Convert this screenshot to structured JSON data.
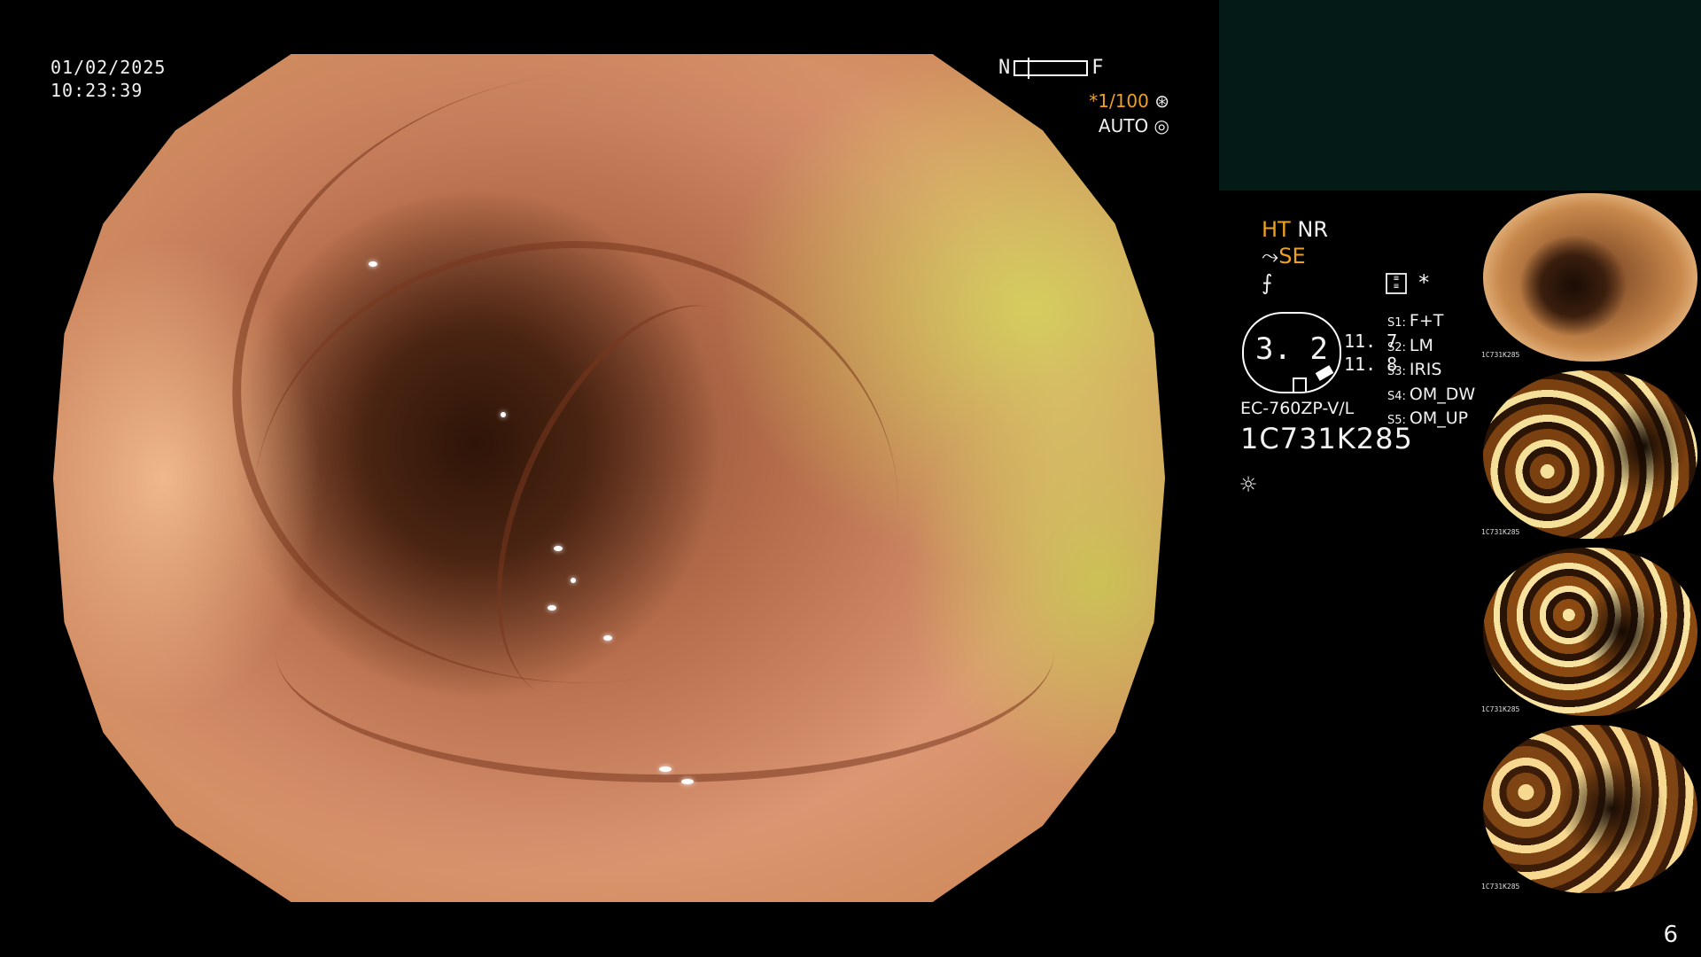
{
  "overlay": {
    "date": "01/02/2025",
    "time": "10:23:39",
    "focus_near": "N",
    "focus_far": "F",
    "shutter": "*1/100",
    "iris_mode": "AUTO"
  },
  "panel": {
    "mode_ht": "HT",
    "mode_nr": "NR",
    "mode_se": "SE",
    "asterisk": "*",
    "magnification": "3. 2",
    "value_1": "11. 7",
    "value_2": "11. 8",
    "settings": [
      {
        "key": "S1:",
        "value": "F+T"
      },
      {
        "key": "S2:",
        "value": "LM"
      },
      {
        "key": "S3:",
        "value": "IRIS"
      },
      {
        "key": "S4:",
        "value": "OM_DW"
      },
      {
        "key": "S5:",
        "value": "OM_UP"
      }
    ],
    "scope_model": "EC-760ZP-V/L",
    "scope_serial": "1C731K285"
  },
  "thumbnails": [
    {
      "caption": "1C731K285"
    },
    {
      "caption": "1C731K285"
    },
    {
      "caption": "1C731K285"
    },
    {
      "caption": "1C731K285"
    }
  ],
  "page_number": "6",
  "icons": [
    "sun-icon",
    "filter-icon",
    "aperture-icon",
    "shutter-icon",
    "scope-tip-icon"
  ],
  "colors": {
    "background": "#000000",
    "accent": "#f0a020",
    "topbox": "#031a17"
  }
}
